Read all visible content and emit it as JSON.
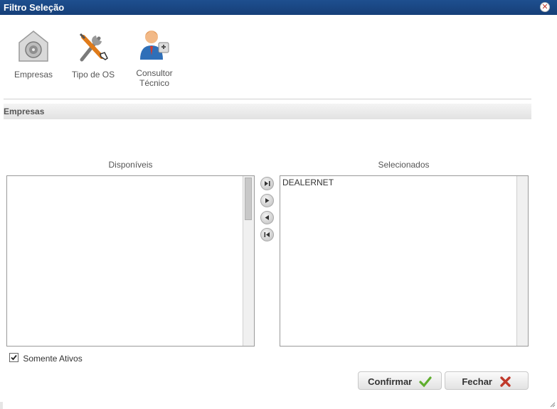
{
  "window": {
    "title": "Filtro Seleção",
    "close_icon": "close-icon"
  },
  "toolbar": {
    "items": [
      {
        "label": "Empresas",
        "icon": "vault-icon"
      },
      {
        "label": "Tipo de OS",
        "icon": "tools-icon"
      },
      {
        "label_line1": "Consultor",
        "label_line2": "Técnico",
        "icon": "consultant-icon"
      }
    ]
  },
  "section": {
    "title": "Empresas"
  },
  "lists": {
    "available": {
      "label": "Disponíveis",
      "items": []
    },
    "selected": {
      "label": "Selecionados",
      "items": [
        "DEALERNET"
      ]
    }
  },
  "move_buttons": [
    "move-all-right-icon",
    "move-right-icon",
    "move-left-icon",
    "move-all-left-icon"
  ],
  "filter": {
    "only_active_label": "Somente Ativos",
    "only_active_checked": true
  },
  "actions": {
    "confirm_label": "Confirmar",
    "close_label": "Fechar"
  },
  "colors": {
    "titlebar": "#1e4f8f",
    "confirm_check": "#5fae2e",
    "close_x": "#c0392b"
  }
}
